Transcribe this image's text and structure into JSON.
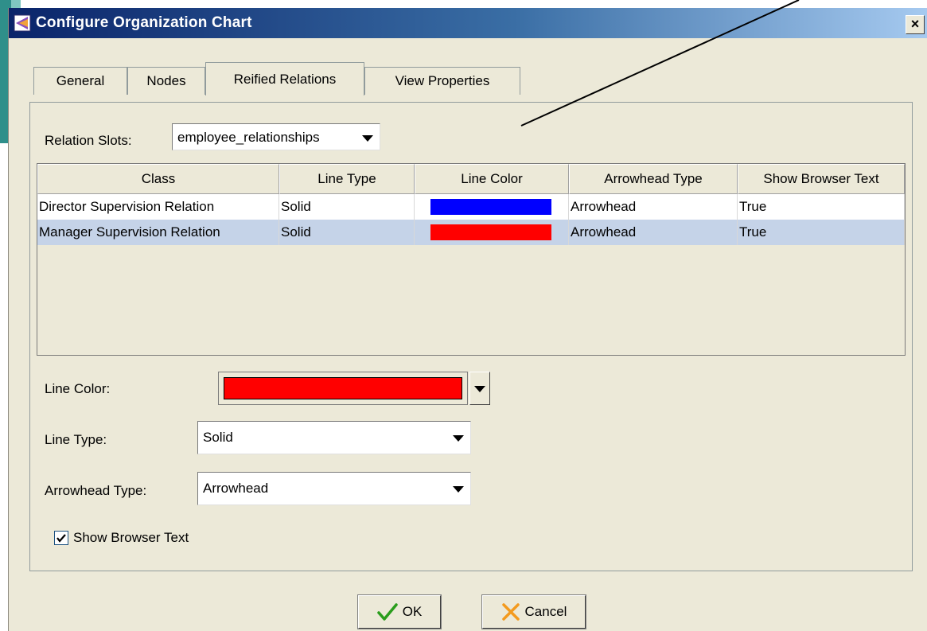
{
  "window": {
    "title": "Configure Organization Chart",
    "close_glyph": "×"
  },
  "tabs": [
    {
      "label": "General",
      "active": false
    },
    {
      "label": "Nodes",
      "active": false
    },
    {
      "label": "Reified Relations",
      "active": true
    },
    {
      "label": "View Properties",
      "active": false
    }
  ],
  "relation_slots": {
    "label": "Relation Slots:",
    "value": "employee_relationships"
  },
  "table": {
    "columns": [
      "Class",
      "Line Type",
      "Line Color",
      "Arrowhead Type",
      "Show Browser Text"
    ],
    "rows": [
      {
        "class": "Director Supervision Relation",
        "line_type": "Solid",
        "line_color": "#0000ff",
        "arrowhead_type": "Arrowhead",
        "show_browser_text": "True",
        "selected": false
      },
      {
        "class": "Manager Supervision Relation",
        "line_type": "Solid",
        "line_color": "#ff0000",
        "arrowhead_type": "Arrowhead",
        "show_browser_text": "True",
        "selected": true
      }
    ]
  },
  "form": {
    "line_color": {
      "label": "Line Color:",
      "value": "#ff0000"
    },
    "line_type": {
      "label": "Line Type:",
      "value": "Solid"
    },
    "arrowhead_type": {
      "label": "Arrowhead Type:",
      "value": "Arrowhead"
    },
    "show_browser_text": {
      "label": "Show Browser Text",
      "checked": true
    }
  },
  "buttons": {
    "ok": "OK",
    "cancel": "Cancel"
  },
  "colors": {
    "ok_icon": "#2a9d1c",
    "cancel_icon": "#f39a1e",
    "selection": "#c5d3e8",
    "titlebar": "#0a246a"
  },
  "icons": {
    "ok": "checkmark-icon",
    "cancel": "x-icon",
    "dropdown": "chevron-down-icon",
    "app": "protege-icon"
  }
}
